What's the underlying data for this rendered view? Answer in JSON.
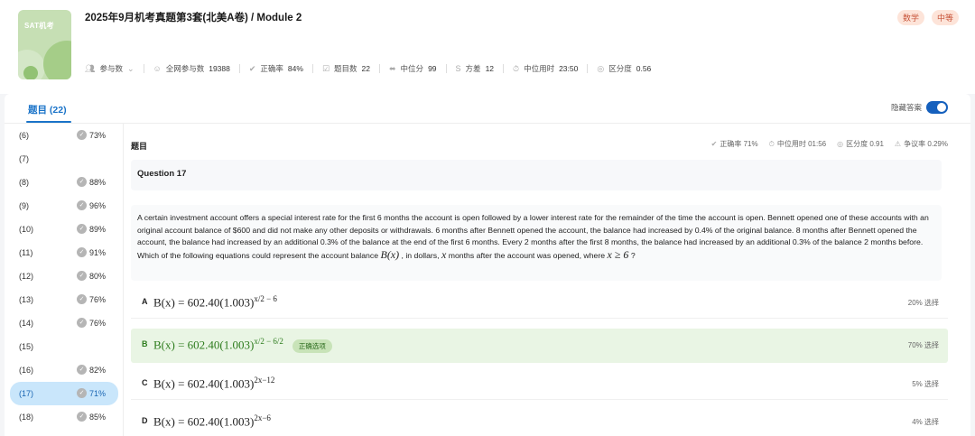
{
  "header": {
    "cover_label": "SAT机考",
    "title": "2025年9月机考真题第3套(北美A卷) / Module 2",
    "badges": [
      "数学",
      "中等"
    ],
    "stats": {
      "participants_label": "参与数",
      "all_participants_label": "全网参与数",
      "all_participants_value": "19388",
      "accuracy_label": "正确率",
      "accuracy_value": "84%",
      "question_count_label": "题目数",
      "question_count_value": "22",
      "median_label": "中位分",
      "median_value": "99",
      "variance_label": "方差",
      "variance_value": "12",
      "median_time_label": "中位用时",
      "median_time_value": "23:50",
      "discrimination_label": "区分度",
      "discrimination_value": "0.56"
    }
  },
  "tabs": {
    "questions_label": "题目 (22)"
  },
  "toggle": {
    "label": "隐藏答案",
    "on": true
  },
  "question_list": [
    {
      "num": "(6)",
      "pct": "73%"
    },
    {
      "num": "(7)",
      "pct": ""
    },
    {
      "num": "(8)",
      "pct": "88%"
    },
    {
      "num": "(9)",
      "pct": "96%"
    },
    {
      "num": "(10)",
      "pct": "89%"
    },
    {
      "num": "(11)",
      "pct": "91%"
    },
    {
      "num": "(12)",
      "pct": "80%"
    },
    {
      "num": "(13)",
      "pct": "76%"
    },
    {
      "num": "(14)",
      "pct": "76%"
    },
    {
      "num": "(15)",
      "pct": ""
    },
    {
      "num": "(16)",
      "pct": "82%"
    },
    {
      "num": "(17)",
      "pct": "71%"
    },
    {
      "num": "(18)",
      "pct": "85%"
    }
  ],
  "question": {
    "section_label": "题目",
    "stats": {
      "accuracy_label": "正确率",
      "accuracy_value": "71%",
      "median_time_label": "中位用时",
      "median_time_value": "01:56",
      "discrimination_label": "区分度",
      "discrimination_value": "0.91",
      "controversy_label": "争议率",
      "controversy_value": "0.29%"
    },
    "label": "Question 17",
    "stem_part1": "A certain investment account offers a special interest rate for the first 6 months the account is open followed by a lower interest rate for the remainder of the time the account is open. Bennett opened one of these accounts with an original account balance of $600 and did not make any other deposits or withdrawals. 6 months after Bennett opened the account, the balance had increased by 0.4% of the original balance. 8 months after Bennett opened the account, the balance had increased by an additional 0.3% of the balance at the end of the first 6 months. Every 2 months after the first 8 months, the balance had increased by an additional 0.3% of the balance 2 months before. Which of the following equations could represent the account balance ",
    "stem_math1": "B(x)",
    "stem_part2": " , in dollars, ",
    "stem_math2": "x",
    "stem_part3": " months after the account was opened, where ",
    "stem_math3": "x ≥ 6",
    "stem_part4": " ?",
    "options": [
      {
        "letter": "A",
        "base": "B(x) = 602.40(1.003)",
        "exp": "x/2 − 6",
        "pct": "20% 选择",
        "correct": false
      },
      {
        "letter": "B",
        "base": "B(x) = 602.40(1.003)",
        "exp": "x/2 − 6/2",
        "pct": "70% 选择",
        "correct": true,
        "tag": "正确选项"
      },
      {
        "letter": "C",
        "base": "B(x) = 602.40(1.003)",
        "exp": "2x−12",
        "pct": "5% 选择",
        "correct": false
      },
      {
        "letter": "D",
        "base": "B(x) = 602.40(1.003)",
        "exp": "2x−6",
        "pct": "4% 选择",
        "correct": false
      }
    ]
  }
}
